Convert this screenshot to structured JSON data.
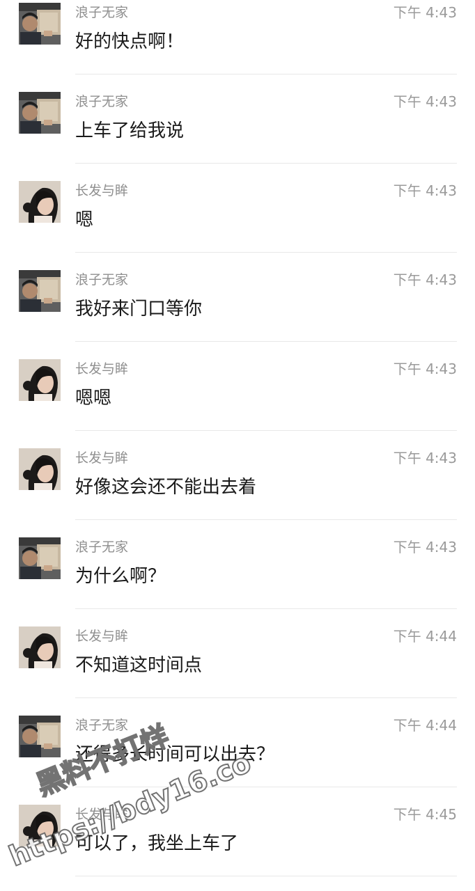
{
  "messages": [
    {
      "sender": "浪子无家",
      "time": "下午 4:43",
      "text": "好的快点啊！",
      "avatar": "male-car-avatar"
    },
    {
      "sender": "浪子无家",
      "time": "下午 4:43",
      "text": "上车了给我说",
      "avatar": "male-car-avatar"
    },
    {
      "sender": "长发与眸",
      "time": "下午 4:43",
      "text": "嗯",
      "avatar": "female-hair-avatar"
    },
    {
      "sender": "浪子无家",
      "time": "下午 4:43",
      "text": "我好来门口等你",
      "avatar": "male-car-avatar"
    },
    {
      "sender": "长发与眸",
      "time": "下午 4:43",
      "text": "嗯嗯",
      "avatar": "female-hair-avatar"
    },
    {
      "sender": "长发与眸",
      "time": "下午 4:43",
      "text": "好像这会还不能出去着",
      "avatar": "female-hair-avatar"
    },
    {
      "sender": "浪子无家",
      "time": "下午 4:43",
      "text": "为什么啊？",
      "avatar": "male-car-avatar"
    },
    {
      "sender": "长发与眸",
      "time": "下午 4:44",
      "text": "不知道这时间点",
      "avatar": "female-hair-avatar"
    },
    {
      "sender": "浪子无家",
      "time": "下午 4:44",
      "text": "还得多长时间可以出去？",
      "avatar": "male-car-avatar"
    },
    {
      "sender": "长发与眸",
      "time": "下午 4:45",
      "text": "可以了，我坐上车了",
      "avatar": "female-hair-avatar"
    }
  ],
  "watermark": {
    "line1": "黑料不打烊",
    "line2": "https://bdy16.co"
  },
  "colors": {
    "background": "#ffffff",
    "sender_text": "#8f8f8f",
    "time_text": "#9a9a9a",
    "message_text": "#1a1a1a",
    "divider": "#e8e8e8"
  }
}
